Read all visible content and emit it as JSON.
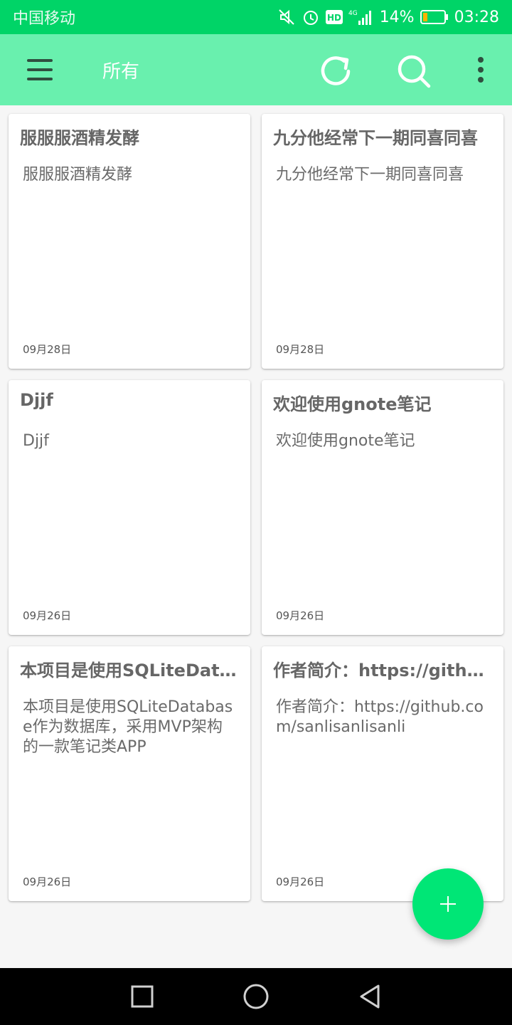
{
  "status_bar": {
    "carrier": "中国移动",
    "network": "4G",
    "hd_label": "HD",
    "battery_pct": "14%",
    "time": "03:28",
    "icons": [
      "mute-icon",
      "alarm-icon",
      "hd-icon",
      "signal-icon",
      "battery-icon"
    ]
  },
  "app_bar": {
    "title": "所有",
    "icons": [
      "menu-icon",
      "refresh-icon",
      "search-icon",
      "more-icon"
    ]
  },
  "notes": [
    {
      "title": "服服服酒精发酵",
      "body": "服服服酒精发酵",
      "date": "09月28日"
    },
    {
      "title": "九分他经常下一期同喜同喜",
      "body": "九分他经常下一期同喜同喜",
      "date": "09月28日"
    },
    {
      "title": "Djjf",
      "body": "Djjf",
      "date": "09月26日"
    },
    {
      "title": "欢迎使用gnote笔记",
      "body": "欢迎使用gnote笔记",
      "date": "09月26日"
    },
    {
      "title": "本项目是使用SQLiteDatabase作为数据库，采用MVP架构的一款笔记类APP",
      "body": "本项目是使用SQLiteDatabase作为数据库，采用MVP架构的一款笔记类APP",
      "date": "09月26日"
    },
    {
      "title": "作者简介：https://github.com/sanlisanlisanli",
      "body": "作者简介：https://github.com/sanlisanlisanli",
      "date": "09月26日"
    }
  ],
  "fab": {
    "icon": "plus-icon"
  },
  "nav_bar": {
    "icons": [
      "recent-apps-icon",
      "home-icon",
      "back-icon"
    ]
  },
  "colors": {
    "status_bar": "#00d467",
    "app_bar": "#69f0ae",
    "fab": "#00e676",
    "background": "#f6f6f6"
  }
}
